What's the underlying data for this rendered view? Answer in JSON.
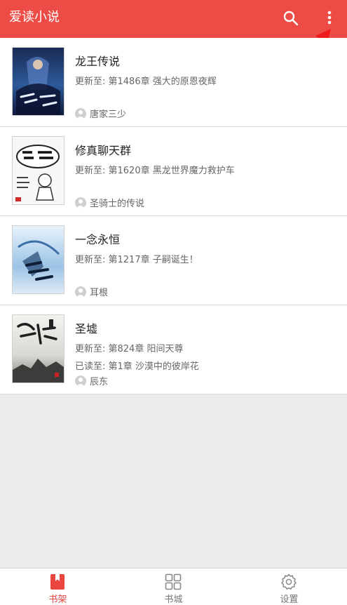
{
  "app": {
    "title": "爱读小说"
  },
  "colors": {
    "accent": "#ed4b45",
    "background": "#ebebeb"
  },
  "toolbar": {
    "search_icon": "search-icon",
    "more_icon": "more-vertical-icon"
  },
  "books": [
    {
      "title": "龙王传说",
      "update": "更新至: 第1486章 强大的原恩夜辉",
      "read": "",
      "author": "唐家三少"
    },
    {
      "title": "修真聊天群",
      "update": "更新至: 第1620章 黑龙世界魔力救护车",
      "read": "",
      "author": "圣骑士的传说"
    },
    {
      "title": "一念永恒",
      "update": "更新至: 第1217章 子嗣诞生！",
      "read": "",
      "author": "耳根"
    },
    {
      "title": "圣墟",
      "update": "更新至: 第824章 阳间天尊",
      "read": "已读至: 第1章 沙漠中的彼岸花",
      "author": "辰东"
    }
  ],
  "bottom_nav": [
    {
      "label": "书架",
      "icon": "bookshelf-icon",
      "active": true
    },
    {
      "label": "书城",
      "icon": "grid-icon",
      "active": false
    },
    {
      "label": "设置",
      "icon": "gear-icon",
      "active": false
    }
  ]
}
